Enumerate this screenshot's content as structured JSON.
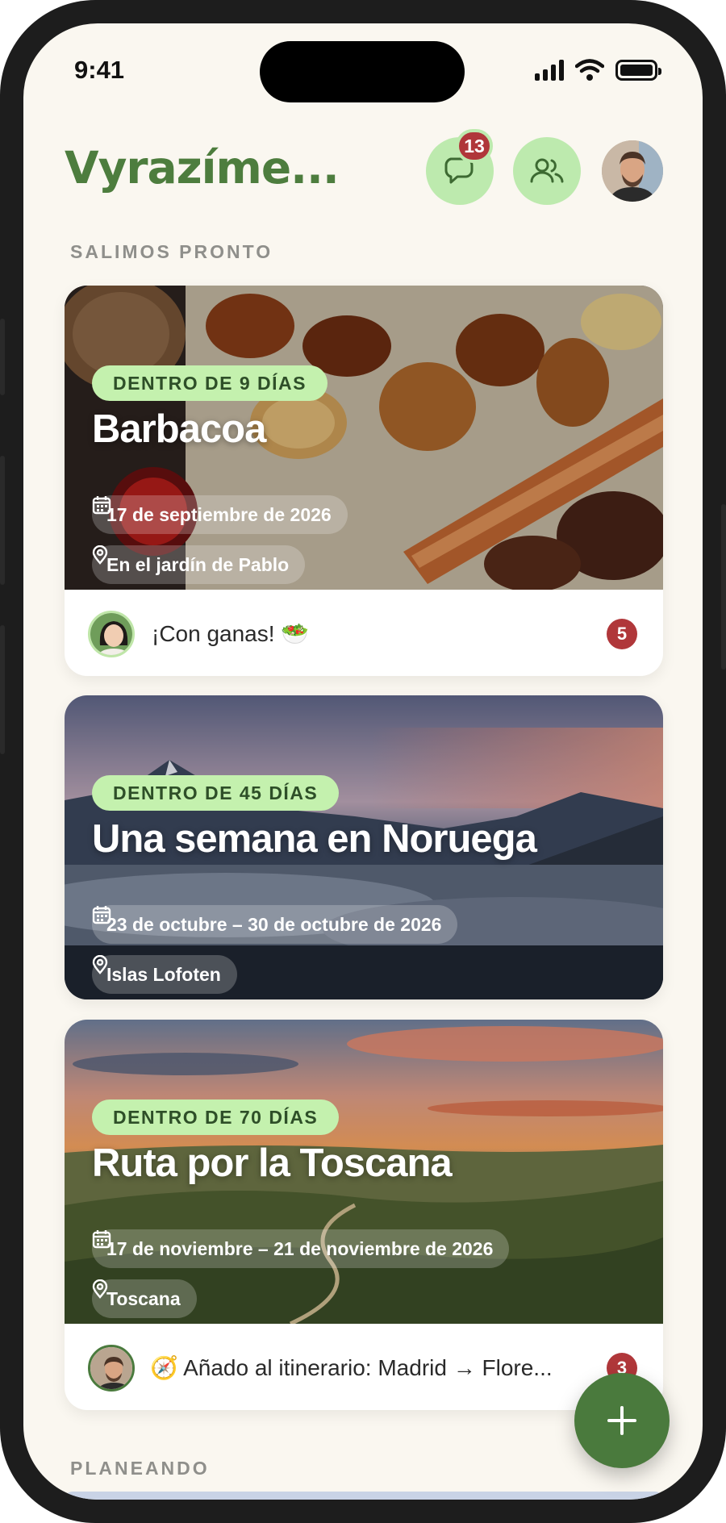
{
  "status_bar": {
    "time": "9:41"
  },
  "header": {
    "title": "Vyrazíme...",
    "chat_badge": "13"
  },
  "sections": {
    "soon": "SALIMOS PRONTO",
    "planning": "PLANEANDO"
  },
  "cards": [
    {
      "days": "DENTRO DE 9 DÍAS",
      "title": "Barbacoa",
      "date": "17 de septiembre de 2026",
      "location": "En el jardín de Pablo",
      "footer_text": "¡Con ganas! 🥗",
      "count": "5"
    },
    {
      "days": "DENTRO DE 45 DÍAS",
      "title": "Una semana en Noruega",
      "date": "23 de octubre – 30 de octubre de 2026",
      "location": "Islas Lofoten"
    },
    {
      "days": "DENTRO DE 70 DÍAS",
      "title": "Ruta por la Toscana",
      "date": "17 de noviembre – 21 de noviembre de 2026",
      "location": "Toscana",
      "footer_text": "🧭 Añado al itinerario: Madrid → Flore...",
      "count": "3"
    }
  ],
  "icons": {
    "chat": "chat-bubbles-icon",
    "people": "people-icon",
    "calendar": "calendar-icon",
    "pin": "map-pin-icon",
    "add": "plus-icon"
  },
  "colors": {
    "brand_green": "#4d7d3e",
    "pill_green": "#c4f1ae",
    "badge_red": "#b0373a",
    "background": "#faf7f0"
  }
}
